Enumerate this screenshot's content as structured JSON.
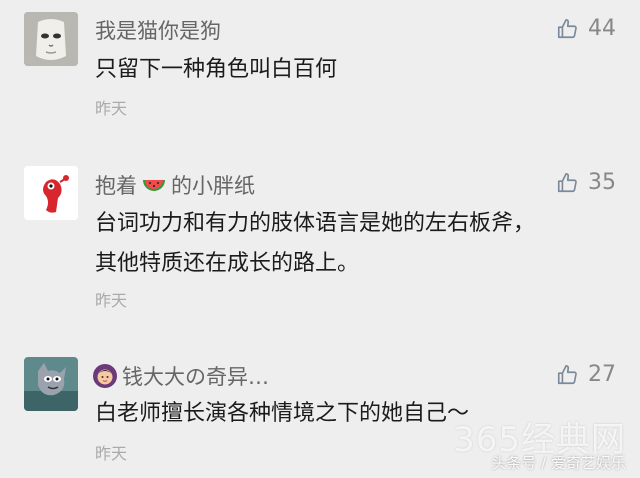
{
  "comments": [
    {
      "user": "我是猫你是狗",
      "avatar": "cat-mask-avatar",
      "likes": "44",
      "text": "只留下一种角色叫白百何",
      "time": "昨天"
    },
    {
      "user_prefix": "抱着",
      "user_emoji": "watermelon-icon",
      "user_suffix": "的小胖纸",
      "avatar": "red-cartoon-avatar",
      "likes": "35",
      "text": "台词功力和有力的肢体语言是她的左右板斧，其他特质还在成长的路上。",
      "time": "昨天"
    },
    {
      "user_emoji": "woman-emoji-icon",
      "user": "钱大大の奇异…",
      "avatar": "tom-cat-avatar",
      "likes": "27",
      "text": "白老师擅长演各种情境之下的她自己～",
      "time": "昨天"
    }
  ],
  "watermark": {
    "site": "365经典网",
    "source": "头条号 / 爱奇艺娱乐"
  }
}
